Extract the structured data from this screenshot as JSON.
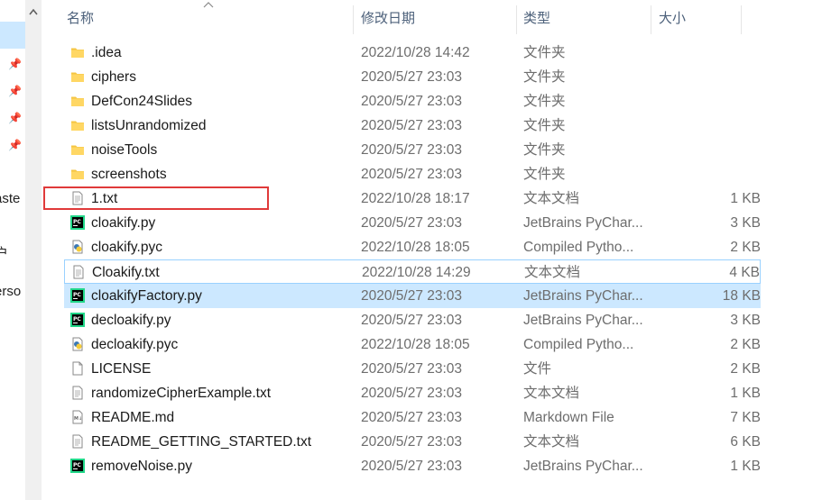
{
  "header": {
    "name_label": "名称",
    "date_label": "修改日期",
    "type_label": "类型",
    "size_label": "大小"
  },
  "nav": {
    "partial_texts": [
      "aste",
      "户",
      "erso"
    ]
  },
  "files": [
    {
      "name": ".idea",
      "date": "2022/10/28 14:42",
      "type": "文件夹",
      "size": "",
      "icon": "folder-icon"
    },
    {
      "name": "ciphers",
      "date": "2020/5/27 23:03",
      "type": "文件夹",
      "size": "",
      "icon": "folder-icon"
    },
    {
      "name": "DefCon24Slides",
      "date": "2020/5/27 23:03",
      "type": "文件夹",
      "size": "",
      "icon": "folder-icon"
    },
    {
      "name": "listsUnrandomized",
      "date": "2020/5/27 23:03",
      "type": "文件夹",
      "size": "",
      "icon": "folder-icon"
    },
    {
      "name": "noiseTools",
      "date": "2020/5/27 23:03",
      "type": "文件夹",
      "size": "",
      "icon": "folder-icon"
    },
    {
      "name": "screenshots",
      "date": "2020/5/27 23:03",
      "type": "文件夹",
      "size": "",
      "icon": "folder-icon"
    },
    {
      "name": "1.txt",
      "date": "2022/10/28 18:17",
      "type": "文本文档",
      "size": "1 KB",
      "icon": "text-file-icon"
    },
    {
      "name": "cloakify.py",
      "date": "2020/5/27 23:03",
      "type": "JetBrains PyChar...",
      "size": "3 KB",
      "icon": "pycharm-icon"
    },
    {
      "name": "cloakify.pyc",
      "date": "2022/10/28 18:05",
      "type": "Compiled Pytho...",
      "size": "2 KB",
      "icon": "python-compiled-icon"
    },
    {
      "name": "Cloakify.txt",
      "date": "2022/10/28 14:29",
      "type": "文本文档",
      "size": "4 KB",
      "icon": "text-file-icon"
    },
    {
      "name": "cloakifyFactory.py",
      "date": "2020/5/27 23:03",
      "type": "JetBrains PyChar...",
      "size": "18 KB",
      "icon": "pycharm-icon"
    },
    {
      "name": "decloakify.py",
      "date": "2020/5/27 23:03",
      "type": "JetBrains PyChar...",
      "size": "3 KB",
      "icon": "pycharm-icon"
    },
    {
      "name": "decloakify.pyc",
      "date": "2022/10/28 18:05",
      "type": "Compiled Pytho...",
      "size": "2 KB",
      "icon": "python-compiled-icon"
    },
    {
      "name": "LICENSE",
      "date": "2020/5/27 23:03",
      "type": "文件",
      "size": "2 KB",
      "icon": "blank-file-icon"
    },
    {
      "name": "randomizeCipherExample.txt",
      "date": "2020/5/27 23:03",
      "type": "文本文档",
      "size": "1 KB",
      "icon": "text-file-icon"
    },
    {
      "name": "README.md",
      "date": "2020/5/27 23:03",
      "type": "Markdown File",
      "size": "7 KB",
      "icon": "markdown-file-icon"
    },
    {
      "name": "README_GETTING_STARTED.txt",
      "date": "2020/5/27 23:03",
      "type": "文本文档",
      "size": "6 KB",
      "icon": "text-file-icon"
    },
    {
      "name": "removeNoise.py",
      "date": "2020/5/27 23:03",
      "type": "JetBrains PyChar...",
      "size": "1 KB",
      "icon": "pycharm-icon"
    }
  ],
  "colors": {
    "selected_bg": "#cce8ff",
    "hover_border": "#99d1ff",
    "annotation_red": "#e03a3a",
    "folder_yellow": "#f7c948"
  }
}
